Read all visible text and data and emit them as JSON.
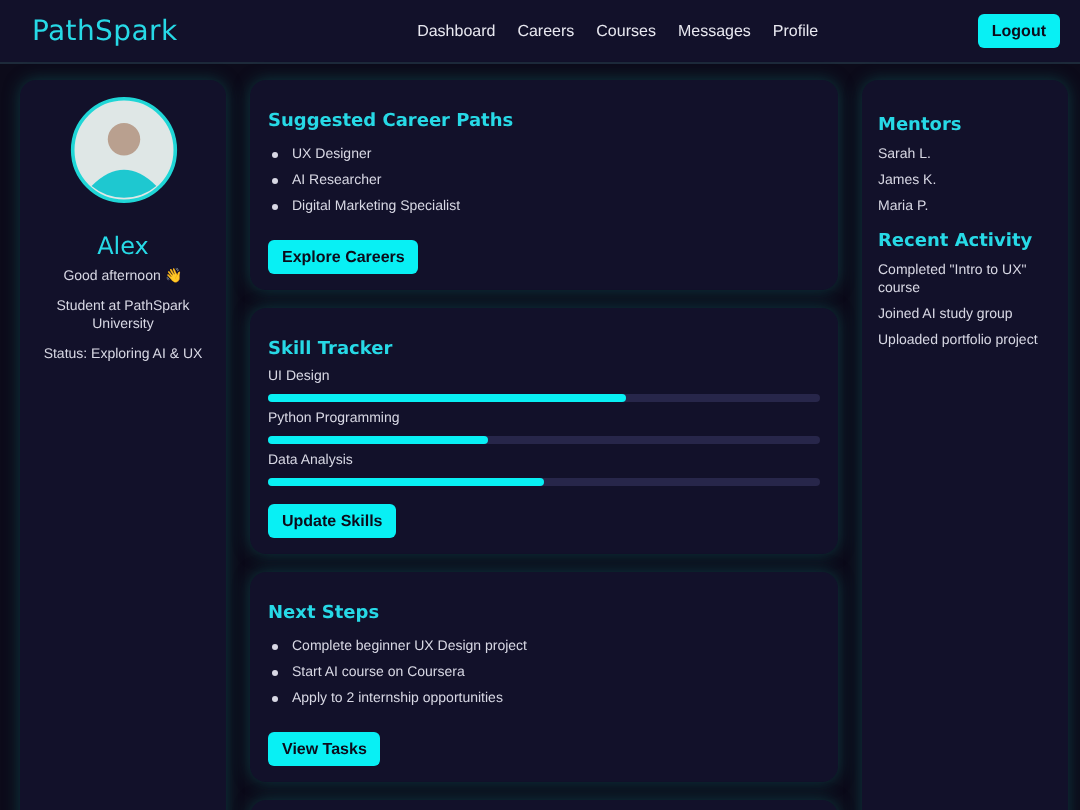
{
  "header": {
    "logo": "PathSpark",
    "nav": [
      {
        "label": "Dashboard"
      },
      {
        "label": "Careers"
      },
      {
        "label": "Courses"
      },
      {
        "label": "Messages"
      },
      {
        "label": "Profile"
      }
    ],
    "logout": "Logout"
  },
  "profile": {
    "name": "Alex",
    "greeting": "Good afternoon 👋",
    "school": "Student at PathSpark University",
    "status": "Status: Exploring AI & UX"
  },
  "careers": {
    "title": "Suggested Career Paths",
    "items": [
      "UX Designer",
      "AI Researcher",
      "Digital Marketing Specialist"
    ],
    "button": "Explore Careers"
  },
  "skills": {
    "title": "Skill Tracker",
    "items": [
      {
        "name": "UI Design",
        "level": 0.65
      },
      {
        "name": "Python Programming",
        "level": 0.4
      },
      {
        "name": "Data Analysis",
        "level": 0.5
      }
    ],
    "button": "Update Skills"
  },
  "next_steps": {
    "title": "Next Steps",
    "items": [
      "Complete beginner UX Design project",
      "Start AI course on Coursera",
      "Apply to 2 internship opportunities"
    ],
    "button": "View Tasks"
  },
  "mentors": {
    "title": "Mentors",
    "items": [
      "Sarah L.",
      "James K.",
      "Maria P."
    ]
  },
  "activity": {
    "title": "Recent Activity",
    "items": [
      "Completed \"Intro to UX\" course",
      "Joined AI study group",
      "Uploaded portfolio project"
    ]
  }
}
